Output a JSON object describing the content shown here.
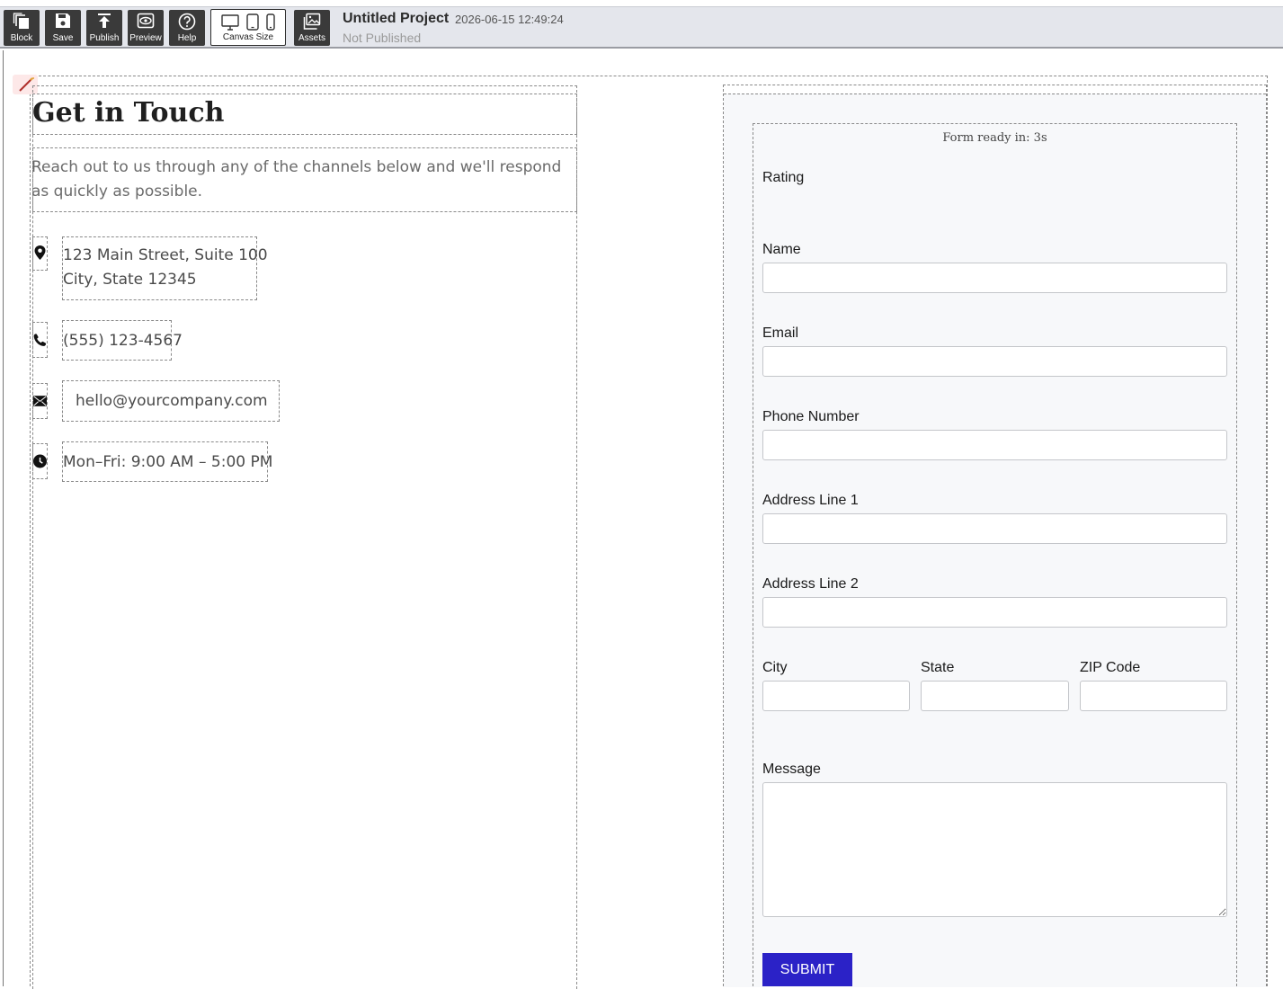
{
  "toolbar": {
    "buttons": [
      {
        "label": "Block",
        "icon": "block-icon"
      },
      {
        "label": "Save",
        "icon": "save-icon"
      },
      {
        "label": "Publish",
        "icon": "publish-icon"
      },
      {
        "label": "Preview",
        "icon": "preview-icon"
      },
      {
        "label": "Help",
        "icon": "help-icon"
      }
    ],
    "canvas_size_label": "Canvas Size",
    "assets_label": "Assets",
    "project_title": "Untitled Project",
    "timestamp": "2026-06-15 12:49:24",
    "status": "Not Published"
  },
  "contact": {
    "heading": "Get in Touch",
    "intro": "Reach out to us through any of the channels below and we'll respond as quickly as possible.",
    "address_line1": "123 Main Street, Suite 100",
    "address_line2": "City, State 12345",
    "phone": "(555) 123-4567",
    "email": "hello@yourcompany.com",
    "hours": "Mon–Fri: 9:00 AM – 5:00 PM"
  },
  "form": {
    "ready_text": "Form ready in: 3s",
    "rating_label": "Rating",
    "name_label": "Name",
    "email_label": "Email",
    "phone_label": "Phone Number",
    "address1_label": "Address Line 1",
    "address2_label": "Address Line 2",
    "city_label": "City",
    "state_label": "State",
    "zip_label": "ZIP Code",
    "message_label": "Message",
    "submit_label": "SUBMIT"
  },
  "colors": {
    "toolbar_bg": "#e4e6ec",
    "button_dark": "#3a3a3a",
    "submit_blue": "#2b22c7",
    "form_bg": "#f7f8fa"
  }
}
